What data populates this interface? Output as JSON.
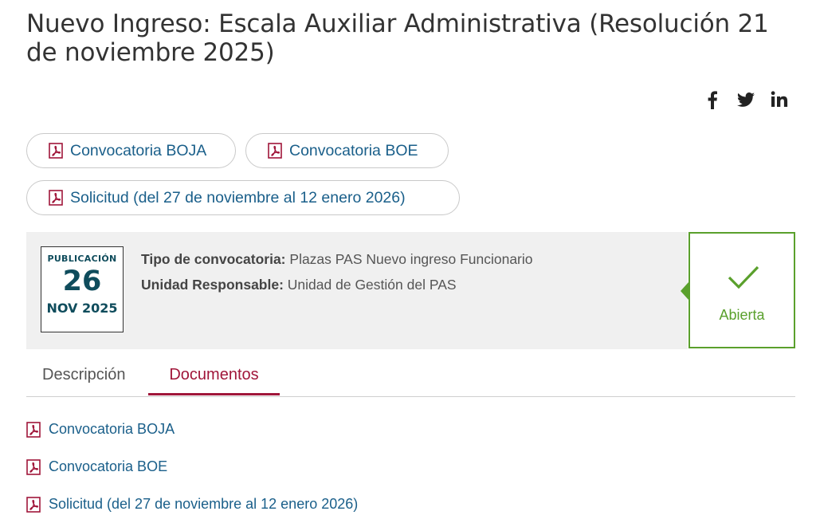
{
  "title": "Nuevo Ingreso: Escala Auxiliar Administrativa (Resolución 21 de noviembre 2025)",
  "social": [
    {
      "icon": "facebook-icon"
    },
    {
      "icon": "twitter-icon"
    },
    {
      "icon": "linkedin-icon"
    }
  ],
  "buttons": [
    {
      "label": "Convocatoria BOJA"
    },
    {
      "label": "Convocatoria BOE"
    },
    {
      "label": "Solicitud (del 27 de noviembre al 12 enero 2026)"
    }
  ],
  "info": {
    "date": {
      "label": "PUBLICACIÓN",
      "day": "26",
      "month_year": "NOV 2025"
    },
    "tipo_label": "Tipo de convocatoria:",
    "tipo_value": "Plazas PAS Nuevo ingreso Funcionario",
    "unidad_label": "Unidad Responsable:",
    "unidad_value": "Unidad de Gestión del PAS"
  },
  "status": {
    "label": "Abierta",
    "color": "#5aa02c"
  },
  "tabs": [
    {
      "label": "Descripción",
      "active": false
    },
    {
      "label": "Documentos",
      "active": true
    }
  ],
  "documents": [
    {
      "label": "Convocatoria BOJA"
    },
    {
      "label": "Convocatoria BOE"
    },
    {
      "label": "Solicitud (del 27 de noviembre al 12 enero 2026)"
    }
  ],
  "colors": {
    "link": "#1a5f8a",
    "accent": "#a0163a",
    "status": "#5aa02c",
    "date": "#0f4c5c"
  }
}
